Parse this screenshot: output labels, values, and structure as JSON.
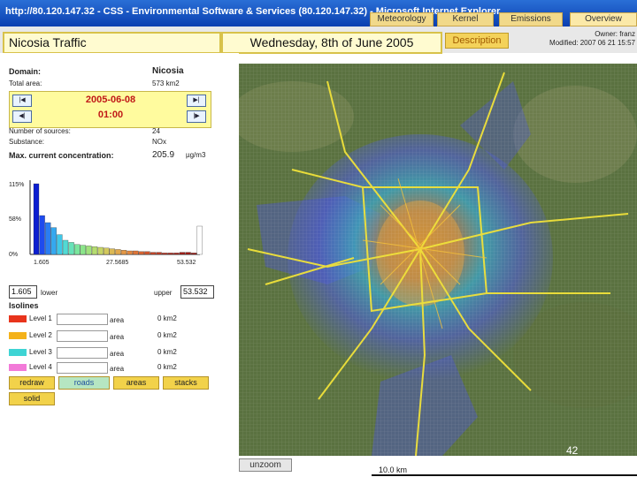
{
  "window": {
    "title": "http://80.120.147.32 - CSS - Environmental Software & Services (80.120.147.32) - Microsoft Internet Explorer"
  },
  "tabs": [
    "Meteorology",
    "Kernel",
    "Emissions",
    "Overview"
  ],
  "header": {
    "app_title": "Nicosia Traffic",
    "date_title": "Wednesday, 8th of June 2005",
    "description_label": "Description",
    "owner": "Owner: franz",
    "modified": "Modified: 2007 06 21 15:57"
  },
  "info": {
    "domain_label": "Domain:",
    "domain_value": "Nicosia",
    "total_area_label": "Total area:",
    "total_area_value": "573 km2",
    "date": "2005-06-08",
    "time": "01:00",
    "nav": {
      "first": "|◀",
      "prev": "◀|",
      "next": "|▶",
      "last": "▶|"
    },
    "sources_label": "Number of sources:",
    "sources_value": "24",
    "substance_label": "Substance:",
    "substance_value": "NOx",
    "maxconc_label": "Max. current concentration:",
    "maxconc_value": "205.9",
    "maxconc_unit": "µg/m3"
  },
  "histogram": {
    "y_labels": [
      "115%",
      "58%",
      "0%"
    ],
    "x_labels": [
      "1.605",
      "27.5685",
      "53.532"
    ],
    "bars": [
      100,
      55,
      45,
      38,
      28,
      20,
      17,
      14,
      13,
      12,
      11,
      10,
      9,
      8,
      7,
      6,
      5,
      5,
      4,
      4,
      3,
      3,
      2,
      2,
      2,
      3,
      3,
      2,
      40
    ],
    "bar_colors": [
      "#0b1ed0",
      "#1e4bee",
      "#2a7df2",
      "#35a8ef",
      "#3fc8e8",
      "#52d9d4",
      "#66e3b8",
      "#7ae69d",
      "#8be58a",
      "#a0e27c",
      "#b5dc70",
      "#c6d566",
      "#d3c85d",
      "#dcb955",
      "#e2a94d",
      "#e49846",
      "#e3873f",
      "#df7639",
      "#d86533",
      "#d0552d",
      "#c84728",
      "#c03b24",
      "#b83020",
      "#b1281c",
      "#ab2219",
      "#a51e17",
      "#a01b15",
      "#9b1913",
      "#ffffff"
    ]
  },
  "range": {
    "lower_value": "1.605",
    "lower_label": "lower",
    "upper_label": "upper",
    "upper_value": "53.532"
  },
  "isolines": {
    "title": "Isolines",
    "levels": [
      {
        "label": "Level 1",
        "color": "#e8341c",
        "area_label": "area",
        "area_value": "0 km2"
      },
      {
        "label": "Level 2",
        "color": "#f4b21a",
        "area_label": "area",
        "area_value": "0 km2"
      },
      {
        "label": "Level 3",
        "color": "#3ed4d4",
        "area_label": "area",
        "area_value": "0 km2"
      },
      {
        "label": "Level 4",
        "color": "#f27ad8",
        "area_label": "area",
        "area_value": "0 km2"
      }
    ]
  },
  "buttons": {
    "redraw": "redraw",
    "roads": "roads",
    "areas": "areas",
    "stacks": "stacks",
    "solid": "solid",
    "unzoom": "unzoom"
  },
  "map": {
    "scale_label": "10.0 km",
    "page_number": "42"
  }
}
